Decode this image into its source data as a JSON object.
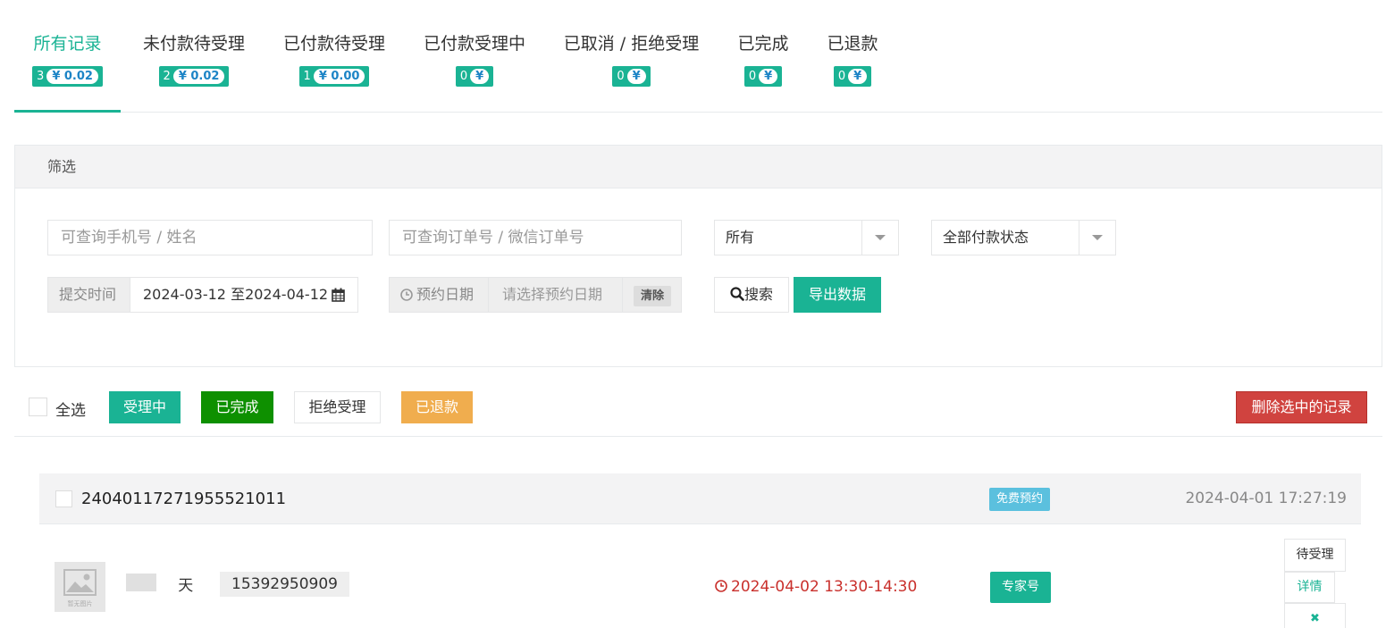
{
  "tabs": [
    {
      "label": "所有记录",
      "count": "3",
      "amount": "¥ 0.02"
    },
    {
      "label": "未付款待受理",
      "count": "2",
      "amount": "¥ 0.02"
    },
    {
      "label": "已付款待受理",
      "count": "1",
      "amount": "¥ 0.00"
    },
    {
      "label": "已付款受理中",
      "count": "0",
      "amount": "¥"
    },
    {
      "label": "已取消 / 拒绝受理",
      "count": "0",
      "amount": "¥"
    },
    {
      "label": "已完成",
      "count": "0",
      "amount": "¥"
    },
    {
      "label": "已退款",
      "count": "0",
      "amount": "¥"
    }
  ],
  "filter": {
    "title": "筛选",
    "phone_placeholder": "可查询手机号 / 姓名",
    "order_placeholder": "可查询订单号 / 微信订单号",
    "select_type": "所有",
    "select_pay": "全部付款状态",
    "submit_time_label": "提交时间",
    "submit_time_value": "2024-03-12 至2024-04-12",
    "booking_date_label": "预约日期",
    "booking_date_placeholder": "请选择预约日期",
    "clear_label": "清除",
    "search_label": "搜索",
    "export_label": "导出数据"
  },
  "actions": {
    "select_all": "全选",
    "processing": "受理中",
    "completed": "已完成",
    "reject": "拒绝受理",
    "refunded": "已退款",
    "delete_selected": "删除选中的记录"
  },
  "record": {
    "order_no": "24040117271955521011",
    "type_tag": "免费预约",
    "created_at": "2024-04-01 17:27:19",
    "no_image": "暂无图片",
    "name": "        天",
    "phone": "15392950909",
    "appointment": "2024-04-02 13:30-14:30",
    "service_tag": "专家号",
    "status_btn": "待受理",
    "detail_btn": "详情",
    "cancel_icon_text": "✖"
  },
  "colors": {
    "primary": "#1ab394",
    "dark_green": "#0e9000",
    "warning": "#f0ad4e",
    "danger": "#d0433f",
    "info": "#5bc0de",
    "badge_amount": "#1c84c6",
    "red_text": "#c9302c"
  }
}
